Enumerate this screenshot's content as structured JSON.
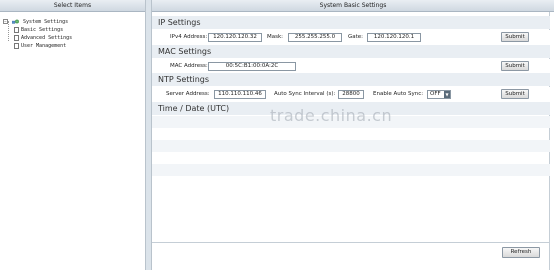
{
  "left_panel": {
    "title": "Select Items",
    "tree": {
      "root_label": "System Settings",
      "root_toggle": "−",
      "items": [
        {
          "label": "Basic Settings"
        },
        {
          "label": "Advanced Settings"
        },
        {
          "label": "User Management"
        }
      ]
    }
  },
  "main": {
    "title": "System Basic Settings",
    "ip_settings": {
      "heading": "IP Settings",
      "ipv4_label": "IPv4 Address:",
      "ipv4_value": "120.120.120.32",
      "mask_label": "Mask:",
      "mask_value": "255.255.255.0",
      "gate_label": "Gate:",
      "gate_value": "120.120.120.1",
      "submit_label": "Submit"
    },
    "mac_settings": {
      "heading": "MAC Settings",
      "mac_label": "MAC Address:",
      "mac_value": "00:5C:B1:00:0A:2C",
      "submit_label": "Submit"
    },
    "ntp_settings": {
      "heading": "NTP Settings",
      "server_label": "Server Address:",
      "server_value": "110.110.110.46",
      "interval_label": "Auto Sync Interval (s):",
      "interval_value": "28800",
      "enable_label": "Enable Auto Sync:",
      "enable_value": "OFF",
      "submit_label": "Submit"
    },
    "time_date": {
      "heading": "Time / Date (UTC)"
    },
    "refresh_label": "Refresh",
    "watermark": "trade.china.cn"
  },
  "colors": {
    "header_gradient_top": "#e9eef3",
    "header_gradient_bottom": "#cfd8e1",
    "section_bg": "#e9eef3"
  },
  "icons": {
    "root": "globe-icon",
    "item": "document-icon",
    "toggle": "collapse-icon",
    "dropdown": "chevron-down-icon"
  }
}
